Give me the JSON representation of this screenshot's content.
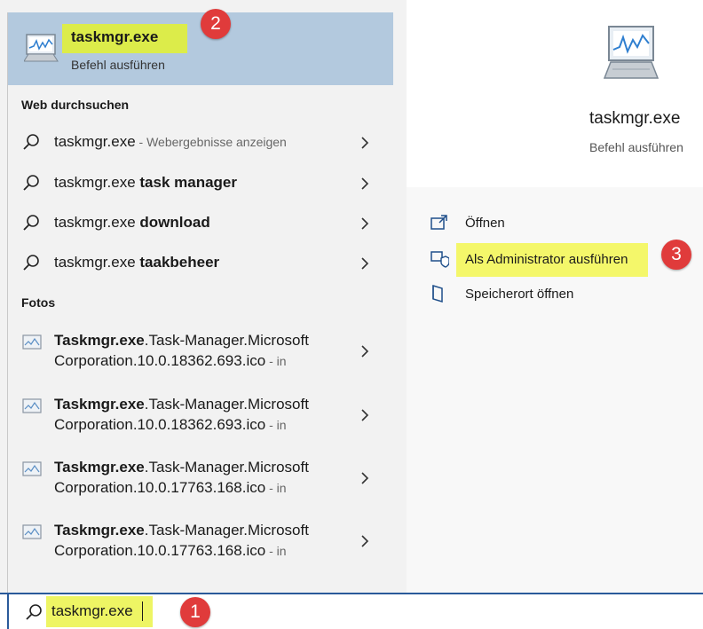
{
  "best_match": {
    "title": "taskmgr.exe",
    "subtitle": "Befehl ausführen",
    "badge": "2"
  },
  "web": {
    "heading": "Web durchsuchen",
    "items": [
      {
        "prefix": "taskmgr.exe",
        "bold": "",
        "suffix": " - Webergebnisse anzeigen"
      },
      {
        "prefix": "taskmgr.exe ",
        "bold": "task manager",
        "suffix": ""
      },
      {
        "prefix": "taskmgr.exe ",
        "bold": "download",
        "suffix": ""
      },
      {
        "prefix": "taskmgr.exe ",
        "bold": "taakbeheer",
        "suffix": ""
      }
    ]
  },
  "photos": {
    "heading": "Fotos",
    "items": [
      {
        "bold": "Taskmgr.exe",
        "line1": ".Task-Manager.Microsoft",
        "line2": "Corporation.10.0.18362.693.ico",
        "suffix": " - in"
      },
      {
        "bold": "Taskmgr.exe",
        "line1": ".Task-Manager.Microsoft",
        "line2": "Corporation.10.0.18362.693.ico",
        "suffix": " - in"
      },
      {
        "bold": "Taskmgr.exe",
        "line1": ".Task-Manager.Microsoft",
        "line2": "Corporation.10.0.17763.168.ico",
        "suffix": " - in"
      },
      {
        "bold": "Taskmgr.exe",
        "line1": ".Task-Manager.Microsoft",
        "line2": "Corporation.10.0.17763.168.ico",
        "suffix": " - in"
      }
    ]
  },
  "detail": {
    "title": "taskmgr.exe",
    "subtitle": "Befehl ausführen",
    "actions": [
      {
        "label": "Öffnen",
        "icon": "open-icon"
      },
      {
        "label": "Als Administrator ausführen",
        "icon": "shield-icon"
      },
      {
        "label": "Speicherort öffnen",
        "icon": "folder-location-icon"
      }
    ],
    "badge": "3"
  },
  "search": {
    "value": "taskmgr.exe",
    "badge": "1"
  },
  "colors": {
    "highlight_yellow": "#e8f24a",
    "best_match_bg": "#b3c9de",
    "badge_red": "#e03b3b",
    "search_border": "#2a5a9a"
  }
}
